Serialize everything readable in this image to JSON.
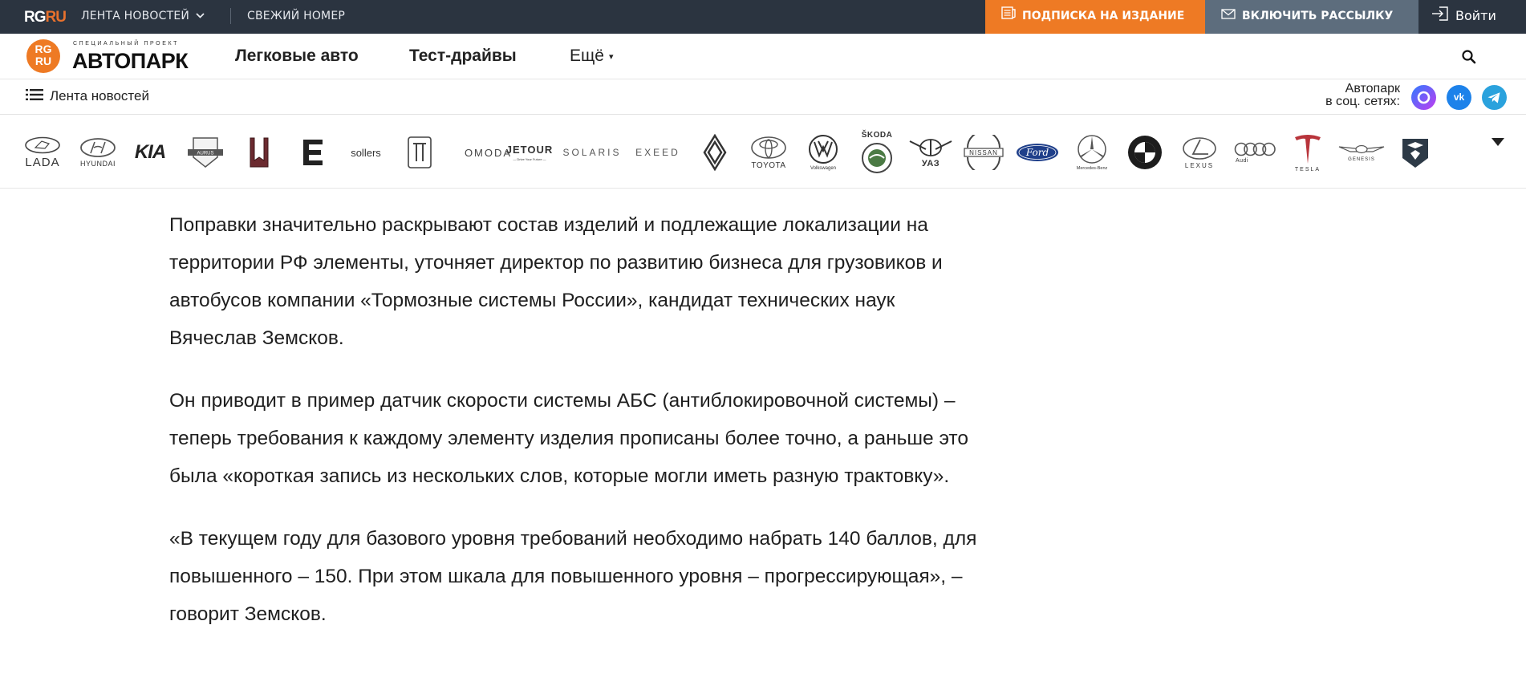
{
  "topbar": {
    "logo_rg": "RG",
    "logo_ru": "RU",
    "news_feed": "ЛЕНТА НОВОСТЕЙ",
    "fresh_issue": "СВЕЖИЙ НОМЕР",
    "subscribe": "ПОДПИСКА НА ИЗДАНИЕ",
    "newsletter": "ВКЛЮЧИТЬ РАССЫЛКУ",
    "login": "Войти"
  },
  "header": {
    "logo_line1": "RG",
    "logo_line2": "RU",
    "special_project": "СПЕЦИАЛЬНЫЙ ПРОЕКТ",
    "brand_name": "АВТОПАРК",
    "nav": [
      "Легковые авто",
      "Тест-драйвы",
      "Ещё"
    ]
  },
  "subheader": {
    "feed_link": "Лента новостей",
    "social_label_1": "Автопарк",
    "social_label_2": "в соц. сетях:",
    "social": {
      "vk": "vk"
    }
  },
  "brands": {
    "lada": "LADA",
    "hyundai": "HYUNDAI",
    "kia": "KIA",
    "aurus": "AURUS",
    "sollers": "sollers",
    "omoda": "OMODA",
    "jetour": "JETOUR",
    "jetour_tagline": "— Drive Your Future —",
    "solaris": "SOLARIS",
    "exeed": "EXEED",
    "toyota": "TOYOTA",
    "volkswagen": "Volkswagen",
    "skoda": "ŠKODA",
    "uaz": "УАЗ",
    "nissan": "NISSAN",
    "ford": "Ford",
    "mercedes": "Mercedes-Benz",
    "lexus": "LEXUS",
    "audi": "Audi",
    "tesla": "TESLA",
    "genesis": "GENESIS"
  },
  "article": {
    "paragraphs": [
      "Поправки значительно раскрывают состав изделий и подлежащие локализации на территории РФ элементы, уточняет директор по развитию бизнеса для грузовиков и автобусов компании «Тормозные системы России», кандидат технических наук Вячеслав Земсков.",
      "Он приводит в пример датчик скорости системы АБС (антиблокировочной системы) – теперь требования к каждому элементу изделия прописаны более точно, а раньше это была «короткая запись из нескольких слов, которые могли иметь разную трактовку».",
      "«В текущем году для базового уровня требований необходимо набрать 140 баллов, для повышенного – 150. При этом шкала для повышенного уровня – прогрессирующая», – говорит Земсков."
    ]
  },
  "colors": {
    "topbar_bg": "#2b3440",
    "accent_orange": "#ee7a24",
    "newsletter_bg": "#5d6d7d"
  }
}
